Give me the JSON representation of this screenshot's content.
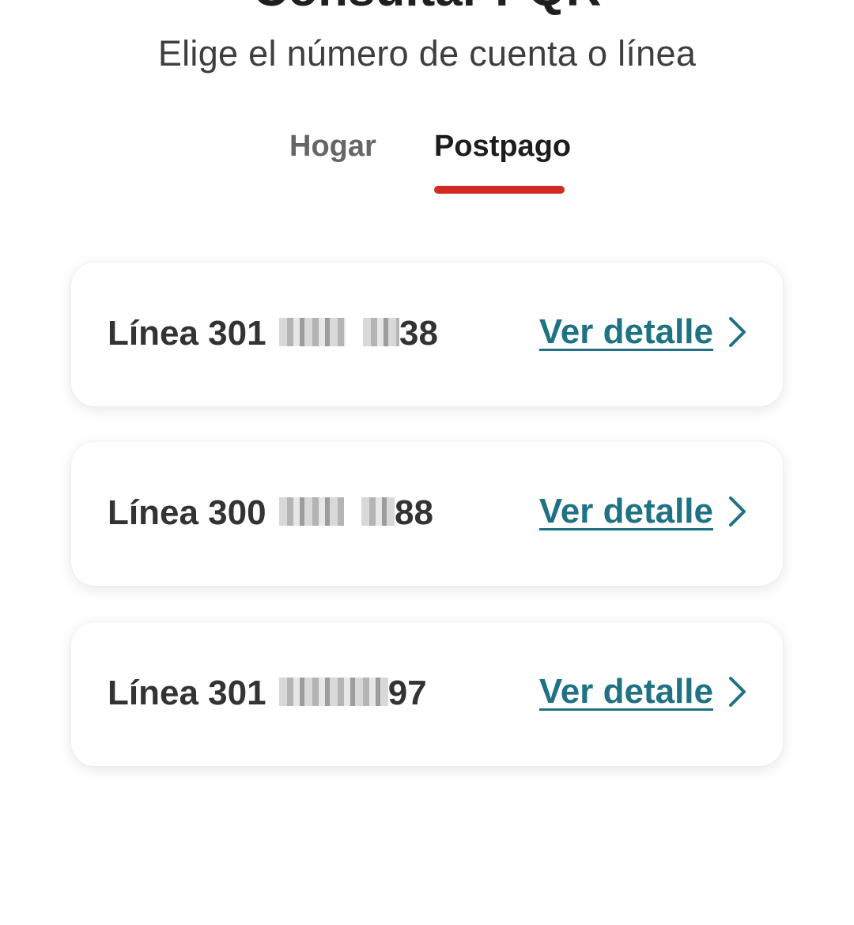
{
  "header": {
    "title": "Consultar PQR",
    "subtitle": "Elige el número de cuenta o línea"
  },
  "tabs": [
    {
      "label": "Hogar",
      "active": false
    },
    {
      "label": "Postpago",
      "active": true
    }
  ],
  "colors": {
    "accent": "#d32a21",
    "link": "#1e7283"
  },
  "lines": [
    {
      "prefix": "Línea 301",
      "suffix": "38",
      "action_label": "Ver detalle",
      "action_icon": "chevron-right-icon"
    },
    {
      "prefix": "Línea 300",
      "suffix": "88",
      "action_label": "Ver detalle",
      "action_icon": "chevron-right-icon"
    },
    {
      "prefix": "Línea 301",
      "suffix": "97",
      "action_label": "Ver detalle",
      "action_icon": "chevron-right-icon"
    }
  ]
}
